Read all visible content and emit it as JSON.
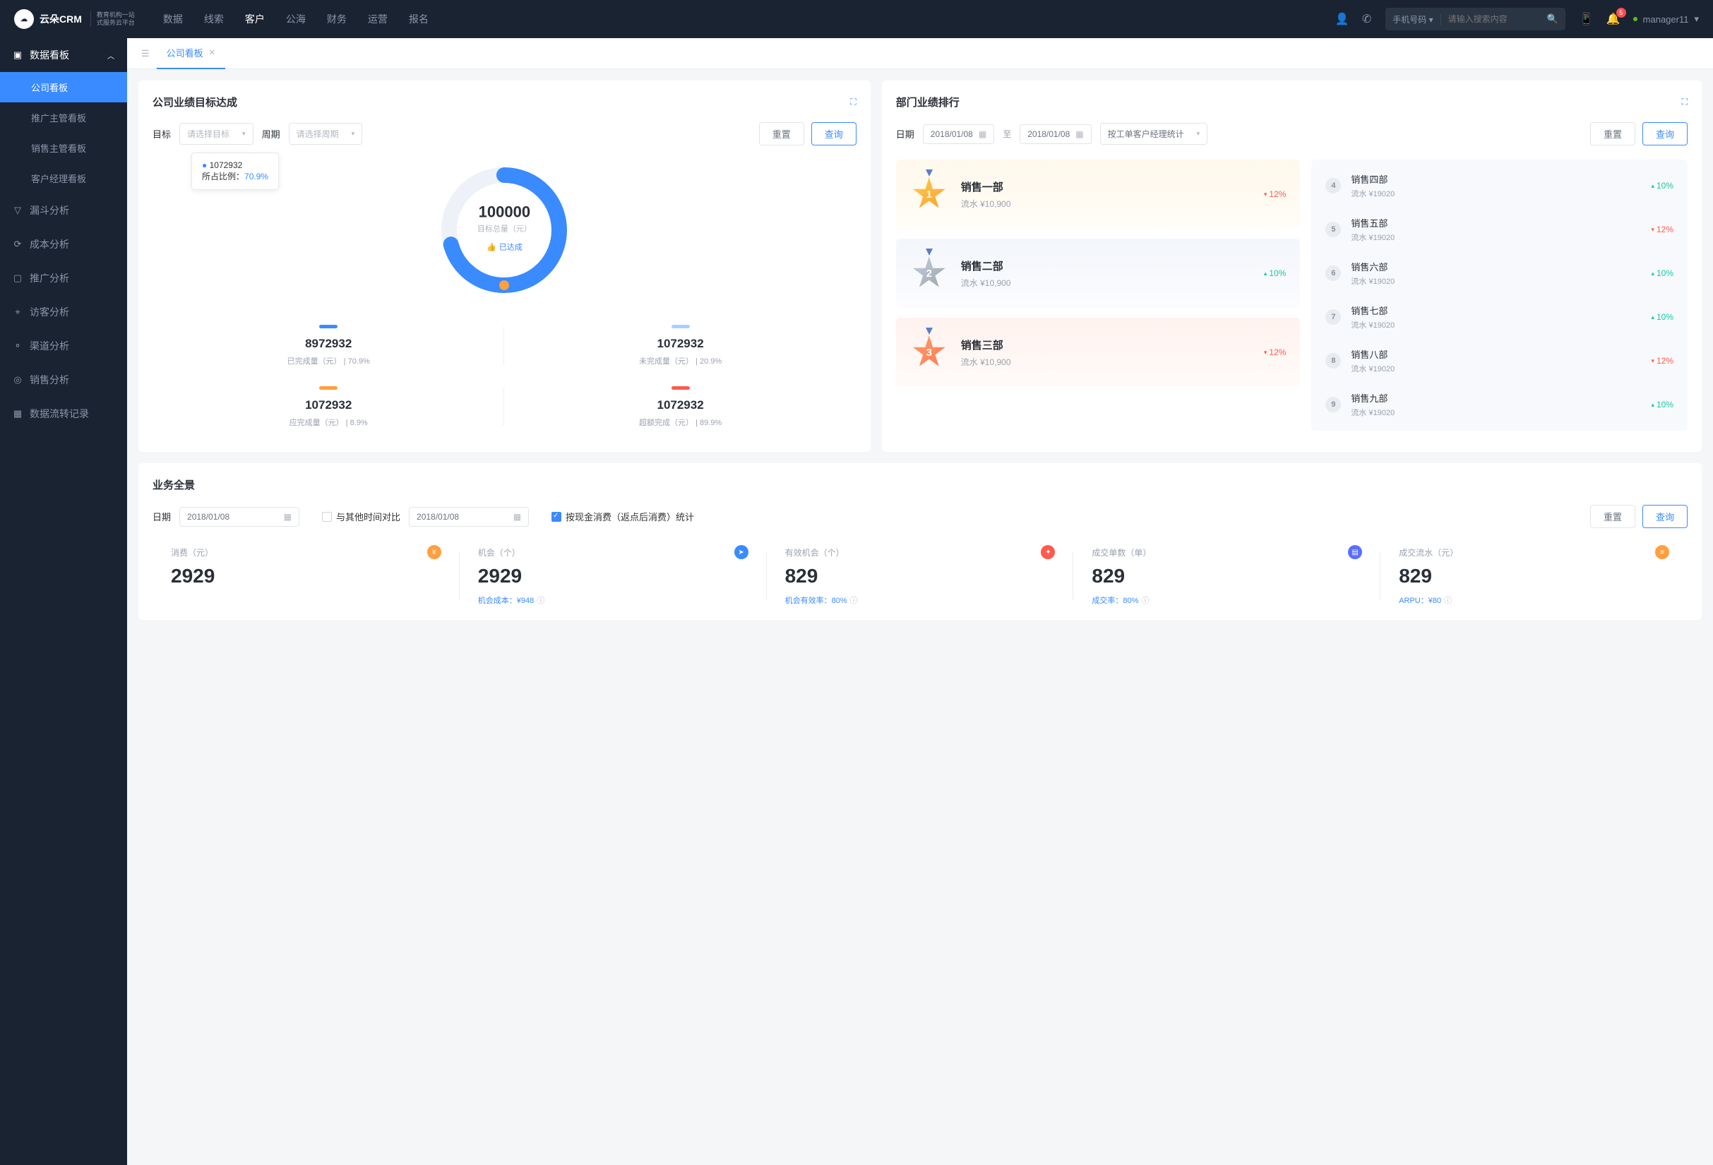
{
  "header": {
    "logo": "云朵CRM",
    "logo_sub1": "教育机构一站",
    "logo_sub2": "式服务云平台",
    "nav": [
      "数据",
      "线索",
      "客户",
      "公海",
      "财务",
      "运营",
      "报名"
    ],
    "active_nav": 2,
    "search_type": "手机号码",
    "search_placeholder": "请输入搜索内容",
    "notif_count": "5",
    "username": "manager11"
  },
  "sidebar": {
    "group_title": "数据看板",
    "group_items": [
      "公司看板",
      "推广主管看板",
      "销售主管看板",
      "客户经理看板"
    ],
    "active_item": 0,
    "singles": [
      {
        "icon": "▽",
        "label": "漏斗分析"
      },
      {
        "icon": "⟳",
        "label": "成本分析"
      },
      {
        "icon": "▢",
        "label": "推广分析"
      },
      {
        "icon": "⌖",
        "label": "访客分析"
      },
      {
        "icon": "⚬",
        "label": "渠道分析"
      },
      {
        "icon": "◎",
        "label": "销售分析"
      },
      {
        "icon": "▦",
        "label": "数据流转记录"
      }
    ]
  },
  "tab": {
    "label": "公司看板"
  },
  "goal_panel": {
    "title": "公司业绩目标达成",
    "target_label": "目标",
    "target_placeholder": "请选择目标",
    "period_label": "周期",
    "period_placeholder": "请选择周期",
    "reset": "重置",
    "query": "查询",
    "tooltip_value": "1072932",
    "tooltip_ratio_label": "所占比例：",
    "tooltip_ratio": "70.9%",
    "gauge_total": "100000",
    "gauge_label": "目标总量（元）",
    "gauge_badge": "已达成",
    "stats": [
      {
        "bar": "blue",
        "num": "8972932",
        "desc": "已完成量（元） | 70.9%"
      },
      {
        "bar": "lblue",
        "num": "1072932",
        "desc": "未完成量（元） | 20.9%"
      },
      {
        "bar": "orange",
        "num": "1072932",
        "desc": "应完成量（元） | 8.9%"
      },
      {
        "bar": "red",
        "num": "1072932",
        "desc": "超额完成（元） | 89.9%"
      }
    ]
  },
  "rank_panel": {
    "title": "部门业绩排行",
    "date_label": "日期",
    "date_from": "2018/01/08",
    "date_to_label": "至",
    "date_to": "2018/01/08",
    "stat_by": "按工单客户经理统计",
    "reset": "重置",
    "query": "查询",
    "top3": [
      {
        "cls": "gold",
        "m": "g",
        "rank": "1",
        "name": "销售一部",
        "sub": "流水 ¥10,900",
        "dir": "down",
        "pct": "12%"
      },
      {
        "cls": "silver",
        "m": "s",
        "rank": "2",
        "name": "销售二部",
        "sub": "流水 ¥10,900",
        "dir": "up",
        "pct": "10%"
      },
      {
        "cls": "bronze",
        "m": "b",
        "rank": "3",
        "name": "销售三部",
        "sub": "流水 ¥10,900",
        "dir": "down",
        "pct": "12%"
      }
    ],
    "rest": [
      {
        "rank": "4",
        "name": "销售四部",
        "sub": "流水 ¥19020",
        "dir": "up",
        "pct": "10%"
      },
      {
        "rank": "5",
        "name": "销售五部",
        "sub": "流水 ¥19020",
        "dir": "down",
        "pct": "12%"
      },
      {
        "rank": "6",
        "name": "销售六部",
        "sub": "流水 ¥19020",
        "dir": "up",
        "pct": "10%"
      },
      {
        "rank": "7",
        "name": "销售七部",
        "sub": "流水 ¥19020",
        "dir": "up",
        "pct": "10%"
      },
      {
        "rank": "8",
        "name": "销售八部",
        "sub": "流水 ¥19020",
        "dir": "down",
        "pct": "12%"
      },
      {
        "rank": "9",
        "name": "销售九部",
        "sub": "流水 ¥19020",
        "dir": "up",
        "pct": "10%"
      }
    ]
  },
  "biz_panel": {
    "title": "业务全景",
    "date_label": "日期",
    "date1": "2018/01/08",
    "compare_label": "与其他时间对比",
    "date2": "2018/01/08",
    "cash_label": "按现金消费（返点后消费）统计",
    "reset": "重置",
    "query": "查询",
    "kpis": [
      {
        "label": "消费（元）",
        "icon_cls": "or",
        "icon": "¥",
        "num": "2929",
        "sub": ""
      },
      {
        "label": "机会（个）",
        "icon_cls": "bl",
        "icon": "➤",
        "num": "2929",
        "sub": "机会成本：¥948"
      },
      {
        "label": "有效机会（个）",
        "icon_cls": "rd",
        "icon": "✦",
        "num": "829",
        "sub": "机会有效率：80%"
      },
      {
        "label": "成交单数（单）",
        "icon_cls": "pu",
        "icon": "▤",
        "num": "829",
        "sub": "成交率：80%"
      },
      {
        "label": "成交流水（元）",
        "icon_cls": "or",
        "icon": "≡",
        "num": "829",
        "sub": "ARPU：¥80"
      }
    ]
  },
  "chart_data": {
    "type": "pie",
    "title": "公司业绩目标达成",
    "total": 100000,
    "achieved_label": "已达成",
    "tooltip": {
      "value": 1072932,
      "ratio": 70.9
    },
    "series": [
      {
        "name": "已完成量（元）",
        "value": 8972932,
        "pct": 70.9,
        "color": "#3a8bff"
      },
      {
        "name": "未完成量（元）",
        "value": 1072932,
        "pct": 20.9,
        "color": "#a8cfff"
      },
      {
        "name": "应完成量（元）",
        "value": 1072932,
        "pct": 8.9,
        "color": "#ff9f40"
      },
      {
        "name": "超额完成（元）",
        "value": 1072932,
        "pct": 89.9,
        "color": "#ff5a4d"
      }
    ]
  }
}
